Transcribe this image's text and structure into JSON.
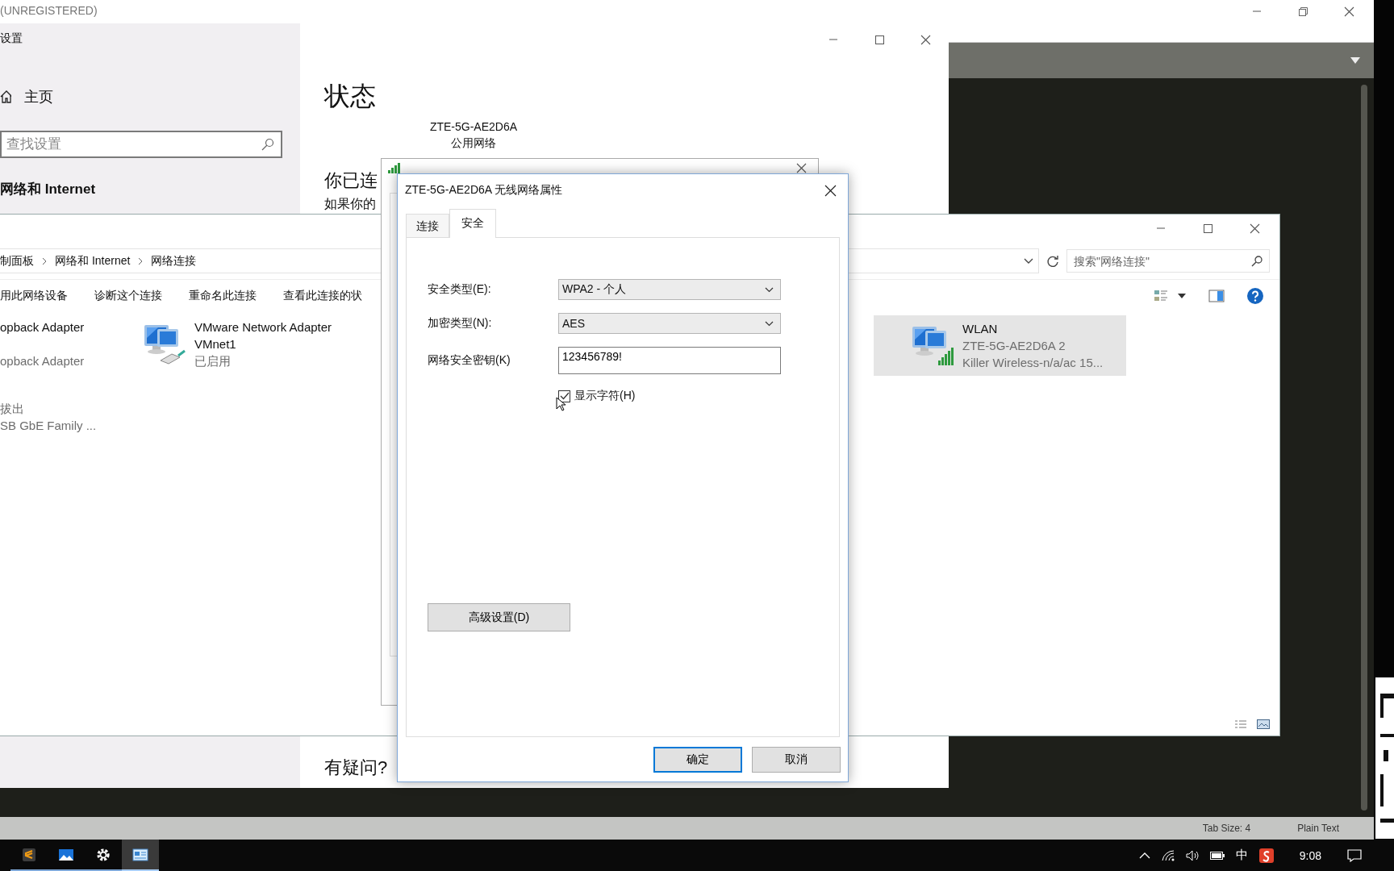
{
  "editor": {
    "title": "(UNREGISTERED)",
    "status_bar": [
      "Tab Size: 4",
      "Plain Text"
    ]
  },
  "settings": {
    "title": "设置",
    "home": "主页",
    "search": {
      "placeholder": "查找设置"
    },
    "section": "网络和 Internet",
    "heading": "状态",
    "network_name": "ZTE-5G-AE2D6A",
    "network_type": "公用网络",
    "connected_text": "你已连",
    "hint_text": "如果你的",
    "help_heading": "有疑问?"
  },
  "explorer": {
    "breadcrumb": [
      "制面板",
      "网络和 Internet",
      "网络连接"
    ],
    "search": {
      "placeholder": "搜索\"网络连接\""
    },
    "commands": [
      "用此网络设备",
      "诊断这个连接",
      "重命名此连接",
      "查看此连接的状"
    ],
    "adapters": [
      {
        "kind": "partial",
        "name": "opback Adapter",
        "device": "opback Adapter",
        "selected": false
      },
      {
        "kind": "wired",
        "name": "VMware Network Adapter VMnet1",
        "status": "已启用",
        "selected": false
      },
      {
        "kind": "wireless",
        "name": "WLAN",
        "status": "ZTE-5G-AE2D6A 2",
        "device": "Killer Wireless-n/a/ac 15...",
        "selected": true
      },
      {
        "kind": "partial",
        "status": "拔出",
        "device": "SB GbE Family ...",
        "selected": false
      }
    ]
  },
  "dialog": {
    "title": "ZTE-5G-AE2D6A 无线网络属性",
    "tabs": [
      {
        "label": "连接",
        "selected": false
      },
      {
        "label": "安全",
        "selected": true
      }
    ],
    "fields": [
      {
        "kind": "dropdown",
        "label": "安全类型(E):",
        "value": "WPA2 - 个人"
      },
      {
        "kind": "dropdown",
        "label": "加密类型(N):",
        "value": "AES"
      },
      {
        "kind": "text",
        "label": "网络安全密钥(K)",
        "value": "123456789!"
      }
    ],
    "show_characters": {
      "label": "显示字符(H)",
      "checked": true
    },
    "advanced_button": "高级设置(D)",
    "buttons": [
      {
        "label": "确定",
        "default": true
      },
      {
        "label": "取消",
        "default": false
      }
    ]
  },
  "taskbar": {
    "apps": [
      {
        "kind": "editor",
        "selected": false
      },
      {
        "kind": "photos",
        "selected": false
      },
      {
        "kind": "settings",
        "selected": false
      },
      {
        "kind": "control-panel",
        "selected": true
      }
    ],
    "ime": "中",
    "time": "9:08"
  }
}
